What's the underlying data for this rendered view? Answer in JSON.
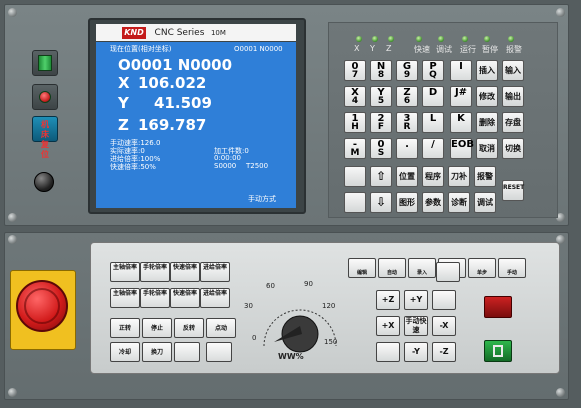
{
  "title_bar": {
    "brand": "KND",
    "series": "CNC Series",
    "model": "10M"
  },
  "screen": {
    "pos_label": "现在位置(相对坐标)",
    "prog_ref": "O0001 N0000",
    "program_line": "O0001 N0000",
    "x_label": "X",
    "x_value": "106.022",
    "y_label": "Y",
    "y_value": "41.509",
    "z_label": "Z",
    "z_value": "169.787",
    "info": {
      "manual_speed": "手动速率:126.0",
      "actual_speed": "实际速率:0",
      "feed_rate": "进给倍率:100%",
      "rapid_rate": "快速倍率:50%",
      "parts": "加工件数:0",
      "time": "0:00:00",
      "s_value": "S0000",
      "t_value": "T2500"
    },
    "mode": "手动方式"
  },
  "left_buttons": {
    "reset_label": "机床复位"
  },
  "leds": [
    "X",
    "Y",
    "Z",
    "快速",
    "调试",
    "运行",
    "暂停",
    "报警"
  ],
  "keypad": {
    "rows": [
      [
        {
          "m": "0",
          "s": "7"
        },
        {
          "m": "N",
          "s": "8"
        },
        {
          "m": "G",
          "s": "9"
        },
        {
          "m": "P",
          "s": "Q"
        },
        {
          "m": "I"
        }
      ],
      [
        {
          "m": "X",
          "s": "4"
        },
        {
          "m": "Y",
          "s": "5"
        },
        {
          "m": "Z",
          "s": "6"
        },
        {
          "m": "D"
        },
        {
          "m": "J#"
        }
      ],
      [
        {
          "m": "1",
          "s": "H"
        },
        {
          "m": "2",
          "s": "F"
        },
        {
          "m": "3",
          "s": "R"
        },
        {
          "m": "L"
        },
        {
          "m": "K"
        }
      ],
      [
        {
          "m": "-",
          "s": "M"
        },
        {
          "m": "0",
          "s": "S"
        },
        {
          "m": "."
        },
        {
          "m": "/"
        },
        {
          "m": "EOB"
        }
      ]
    ],
    "func_right": [
      [
        "插入",
        "输入"
      ],
      [
        "修改",
        "输出"
      ],
      [
        "删除",
        "存盘"
      ],
      [
        "取消",
        "切换"
      ]
    ],
    "bottom_row1": [
      "位置",
      "程序",
      "刀补",
      "报警"
    ],
    "bottom_row2": [
      "图形",
      "参数",
      "诊断",
      "调试"
    ],
    "reset": "RESET"
  },
  "control": {
    "rates": [
      [
        "主轴倍率",
        "手轮倍率",
        "快速倍率",
        "进给倍率"
      ],
      [
        "主轴倍率",
        "手轮倍率",
        "快速倍率",
        "进给倍率"
      ]
    ],
    "spindle": [
      "正转",
      "停止",
      "反转",
      "点动"
    ],
    "misc": [
      "冷却",
      "换刀"
    ],
    "modes": [
      "编辑",
      "自动",
      "录入",
      "回零",
      "单步",
      "手动"
    ],
    "axes": [
      "+Z",
      "+Y",
      "",
      "+X",
      "手动快速",
      "-X",
      "",
      "-Y",
      "-Z"
    ],
    "dial": {
      "labels": [
        "0",
        "30",
        "60",
        "90",
        "120",
        "150"
      ],
      "unit": "WW%"
    }
  }
}
